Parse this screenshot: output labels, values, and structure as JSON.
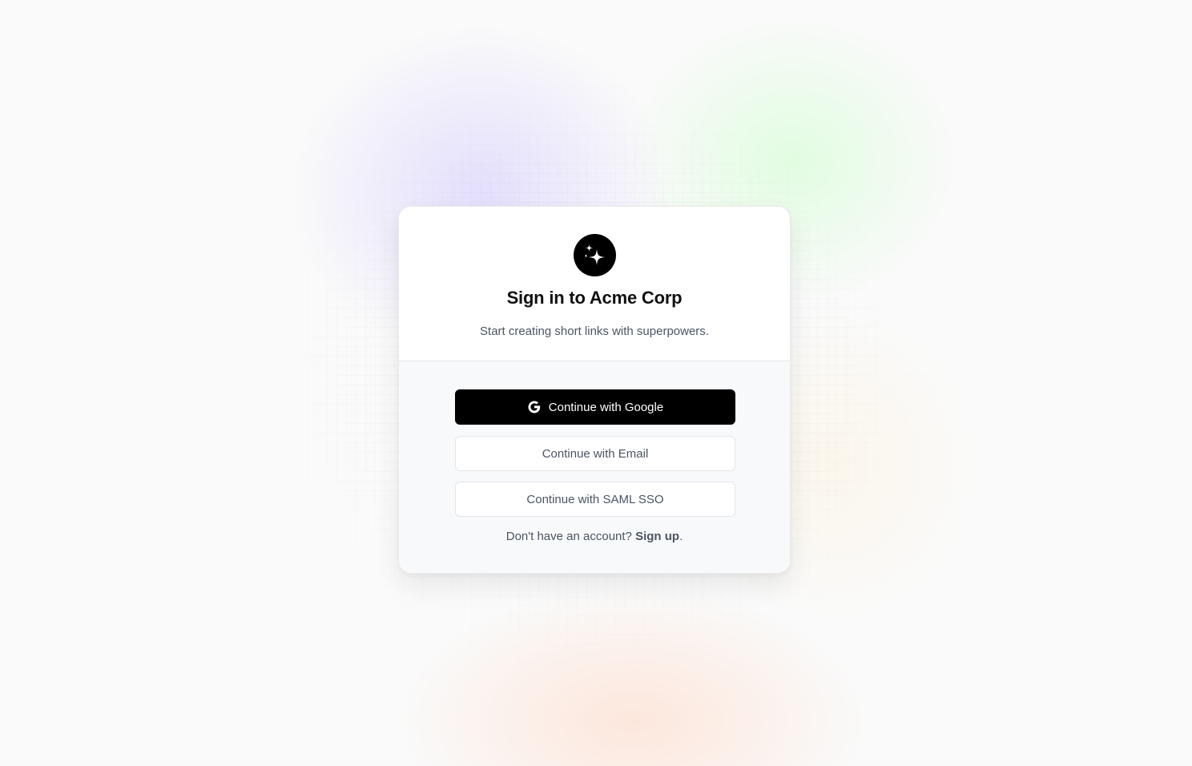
{
  "app": {
    "logo_icon": "sparkles-icon",
    "title": "Sign in to Acme Corp",
    "subtitle": "Start creating short links with superpowers."
  },
  "auth": {
    "google": {
      "label": "Continue with Google",
      "icon": "google-icon"
    },
    "email": {
      "label": "Continue with Email"
    },
    "saml": {
      "label": "Continue with SAML SSO"
    }
  },
  "signup": {
    "prompt": "Don't have an account?",
    "link_label": "Sign up",
    "suffix": "."
  },
  "colors": {
    "primary_button": "#000000",
    "text_muted": "#4b5563",
    "card_footer_bg": "#f8f9fa"
  }
}
